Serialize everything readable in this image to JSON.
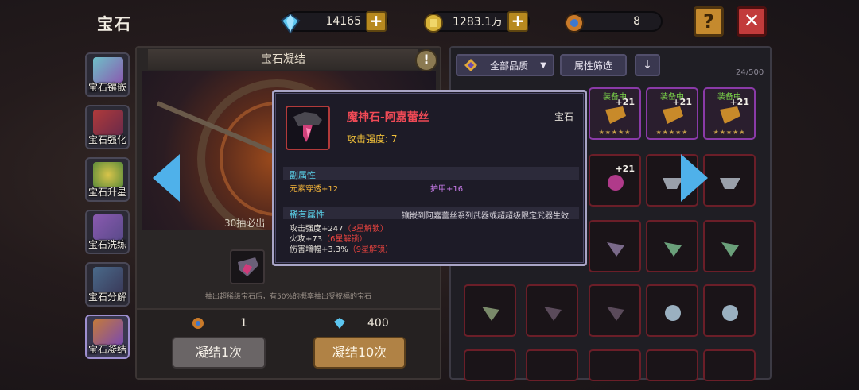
{
  "header": {
    "title": "宝石",
    "currencies": [
      {
        "icon": "diamond-icon",
        "value": "14165",
        "has_plus": true
      },
      {
        "icon": "gold-coin-icon",
        "value": "1283.1万",
        "has_plus": true
      },
      {
        "icon": "summon-token-icon",
        "value": "8",
        "has_plus": false
      }
    ],
    "help_label": "?",
    "close_label": "✕"
  },
  "sidebar": {
    "items": [
      {
        "label": "宝石镶嵌",
        "active": false
      },
      {
        "label": "宝石强化",
        "active": false
      },
      {
        "label": "宝石升星",
        "active": false
      },
      {
        "label": "宝石洗练",
        "active": false
      },
      {
        "label": "宝石分解",
        "active": false
      },
      {
        "label": "宝石凝结",
        "active": true
      }
    ]
  },
  "center": {
    "title": "宝石凝结",
    "info_button": "!",
    "pity_text": "30抽必出",
    "description": "抽出超稀级宝石后，有50%的概率抽出受祝福的宝石",
    "single_cost": "1",
    "multi_cost": "400",
    "button_single": "凝结1次",
    "button_multi": "凝结10次"
  },
  "inventory": {
    "filter_quality": "全部品质",
    "filter_attr": "属性筛选",
    "count": "24/500",
    "equipped_tag": "装备中",
    "slots_row1": [
      {
        "equipped": true,
        "level": "+21",
        "stars": "★★★★★"
      },
      {
        "equipped": true,
        "level": "+21",
        "stars": "★★★★★"
      },
      {
        "equipped": true,
        "level": "+21",
        "stars": "★★★★★"
      }
    ],
    "row2_level": "+21"
  },
  "tooltip": {
    "name": "魔神石-阿嘉蕾丝",
    "category": "宝石",
    "main_stat": "攻击强度: 7",
    "sub_header": "副属性",
    "sub_left": "元素穿透+12",
    "sub_right": "护甲+16",
    "rare_header": "稀有属性",
    "rare_note": "镶嵌到阿嘉蕾丝系列武器或超超级限定武器生效",
    "rare_lines": [
      {
        "text": "攻击强度+247",
        "lock": "（3星解锁）"
      },
      {
        "text": "火攻+73",
        "lock": "（6星解锁）"
      },
      {
        "text": "伤害增幅+3.3%",
        "lock": "（9星解锁）"
      }
    ]
  },
  "colors": {
    "accent_blue": "#4fb1ea",
    "gem_name_red": "#f04a56",
    "main_stat_gold": "#f3c23a",
    "sub_header_cyan": "#5ad0e8",
    "lock_red": "#e8433f",
    "equipped_green": "#7cd84a"
  }
}
